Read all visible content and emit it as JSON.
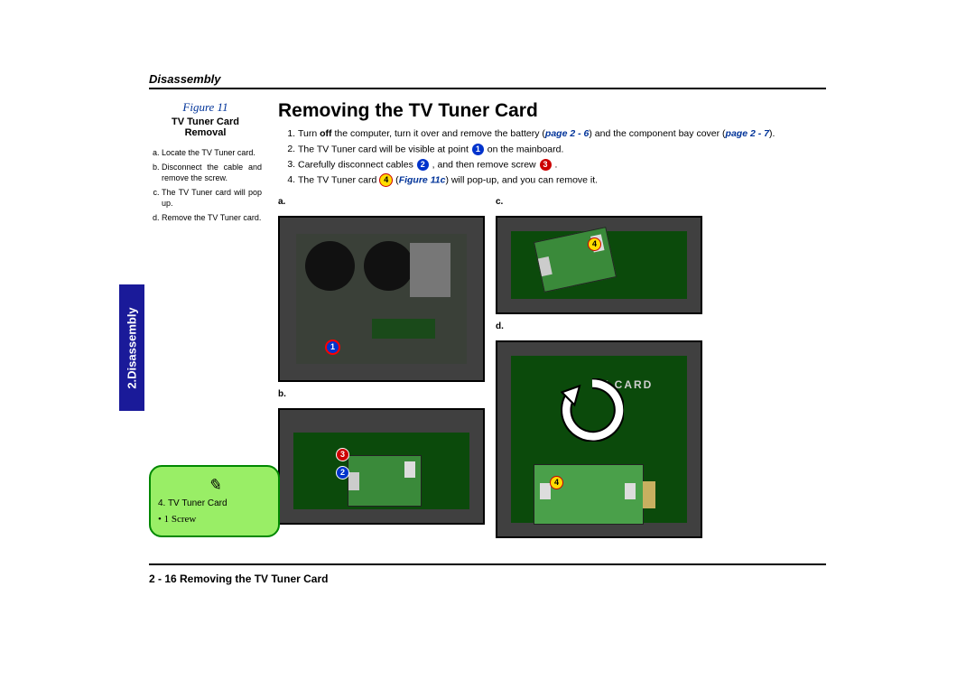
{
  "section_header": "Disassembly",
  "side_tab": "2.Disassembly",
  "figure": {
    "label": "Figure 11",
    "title_line1": "TV Tuner Card",
    "title_line2": "Removal",
    "steps": [
      "Locate the TV Tuner card.",
      "Disconnect the cable and remove the screw.",
      "The TV Tuner card will pop up.",
      "Remove the TV Tuner card."
    ]
  },
  "noteBox": {
    "item": "4. TV Tuner Card",
    "bullet": "1 Screw"
  },
  "main": {
    "title": "Removing the TV Tuner Card",
    "instructions": [
      {
        "pre": "Turn ",
        "bold1": "off",
        "mid1": " the computer, turn it over and remove the battery (",
        "link1": "page 2 - 6",
        "mid2": ") and the component bay cover (",
        "link2": "page 2 - 7",
        "post": ")."
      },
      {
        "text1": "The TV Tuner card will be visible at point ",
        "co1": "1",
        "text2": " on the mainboard."
      },
      {
        "text1": "Carefully disconnect cables ",
        "co1": "2",
        "text2": " , and then remove screw ",
        "co2": "3",
        "text3": " ."
      },
      {
        "text1": "The TV Tuner card ",
        "co1": "4",
        "text2": " (",
        "link1": "Figure 11c",
        "text3": ") will pop-up, and you can remove it."
      }
    ],
    "photoLabels": {
      "a": "a.",
      "b": "b.",
      "c": "c.",
      "d": "d."
    },
    "tvcard_label": "TV  CARD"
  },
  "footer": "2 - 16  Removing the TV Tuner Card"
}
